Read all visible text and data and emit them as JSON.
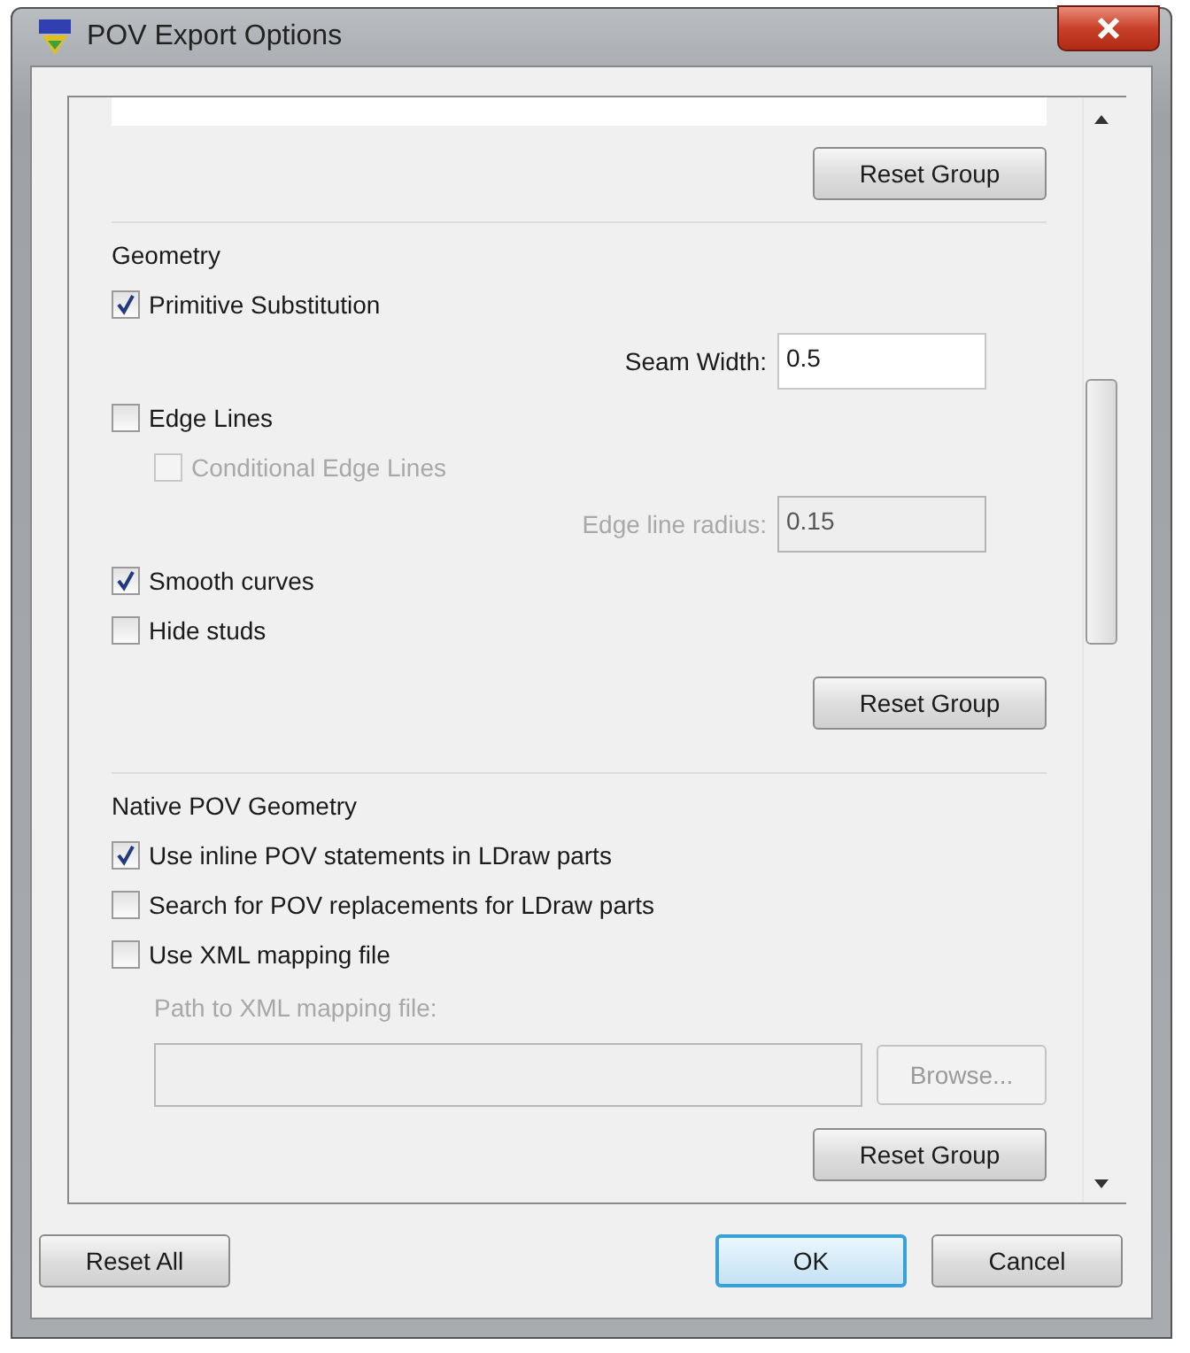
{
  "window": {
    "title": "POV Export Options"
  },
  "top_group": {
    "reset_button": "Reset Group"
  },
  "groups": [
    {
      "title": "Geometry",
      "items": [
        {
          "kind": "checkbox",
          "label": "Primitive Substitution",
          "checked": true,
          "disabled": false
        },
        {
          "kind": "field",
          "label": "Seam Width:",
          "value": "0.5",
          "disabled": false
        },
        {
          "kind": "checkbox",
          "label": "Edge Lines",
          "checked": false,
          "disabled": false
        },
        {
          "kind": "subcheckbox",
          "label": "Conditional Edge Lines",
          "checked": false,
          "disabled": true
        },
        {
          "kind": "field",
          "label": "Edge line radius:",
          "value": "0.15",
          "disabled": true
        },
        {
          "kind": "checkbox",
          "label": "Smooth curves",
          "checked": true,
          "disabled": false
        },
        {
          "kind": "checkbox",
          "label": "Hide studs",
          "checked": false,
          "disabled": false
        }
      ],
      "reset_button": "Reset Group"
    },
    {
      "title": "Native POV Geometry",
      "items": [
        {
          "kind": "checkbox",
          "label": "Use inline POV statements in LDraw parts",
          "checked": true,
          "disabled": false
        },
        {
          "kind": "checkbox",
          "label": "Search for POV replacements for LDraw parts",
          "checked": false,
          "disabled": false
        },
        {
          "kind": "checkbox",
          "label": "Use XML mapping file",
          "checked": false,
          "disabled": false
        },
        {
          "kind": "caption",
          "label": "Path to XML mapping file:",
          "disabled": true
        },
        {
          "kind": "path",
          "button": "Browse...",
          "disabled": true
        }
      ],
      "reset_button": "Reset Group"
    }
  ],
  "buttons": [
    {
      "label": "Reset All",
      "default": false
    },
    {
      "label": "OK",
      "default": true
    },
    {
      "label": "Cancel",
      "default": false
    }
  ]
}
